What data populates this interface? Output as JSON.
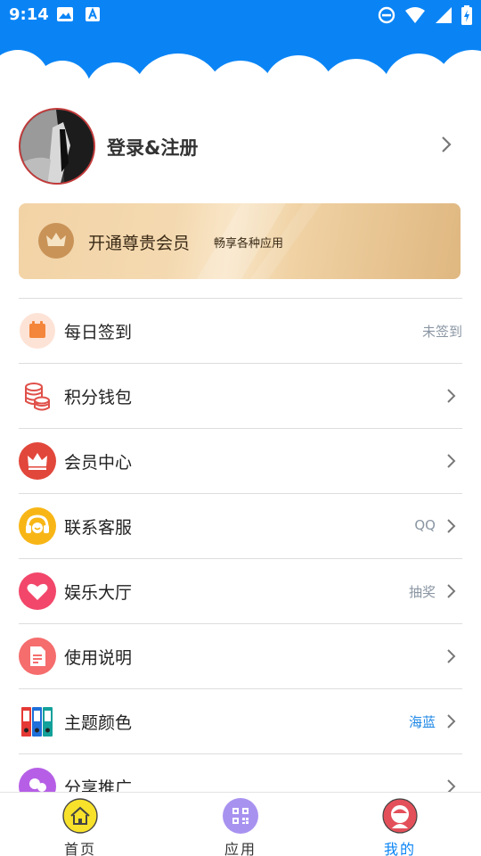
{
  "statusbar": {
    "time": "9:14"
  },
  "profile": {
    "login_label": "登录&注册"
  },
  "vip": {
    "title": "开通尊贵会员",
    "subtitle": "畅享各种应用"
  },
  "menu": {
    "items": [
      {
        "label": "每日签到",
        "value": "未签到",
        "icon": "calendar-icon"
      },
      {
        "label": "积分钱包",
        "value": "",
        "icon": "coins-icon"
      },
      {
        "label": "会员中心",
        "value": "",
        "icon": "crown-icon"
      },
      {
        "label": "联系客服",
        "value": "QQ",
        "icon": "headset-icon"
      },
      {
        "label": "娱乐大厅",
        "value": "抽奖",
        "icon": "heart-icon"
      },
      {
        "label": "使用说明",
        "value": "",
        "icon": "document-icon"
      },
      {
        "label": "主题颜色",
        "value": "海蓝",
        "icon": "binders-icon"
      },
      {
        "label": "分享推广",
        "value": "",
        "icon": "share-icon"
      }
    ]
  },
  "bottom_nav": {
    "items": [
      {
        "label": "首页",
        "icon": "home-icon"
      },
      {
        "label": "应用",
        "icon": "qr-code-icon"
      },
      {
        "label": "我的",
        "icon": "user-icon",
        "active": true
      }
    ]
  },
  "colors": {
    "header": "#0a84f5",
    "accent": "#1e88e5",
    "divider": "#dddddd"
  }
}
